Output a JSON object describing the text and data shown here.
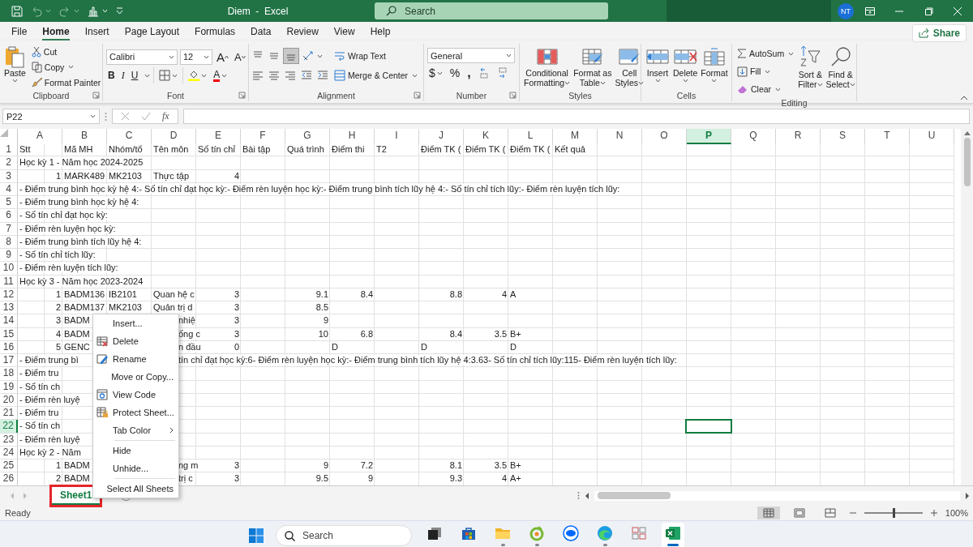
{
  "title_bar": {
    "title": "Diem  -  Excel",
    "search_placeholder": "Search",
    "avatar": "NT"
  },
  "menu_tabs": [
    {
      "label": "File",
      "selected": false
    },
    {
      "label": "Home",
      "selected": true
    },
    {
      "label": "Insert",
      "selected": false
    },
    {
      "label": "Page Layout",
      "selected": false
    },
    {
      "label": "Formulas",
      "selected": false
    },
    {
      "label": "Data",
      "selected": false
    },
    {
      "label": "Review",
      "selected": false
    },
    {
      "label": "View",
      "selected": false
    },
    {
      "label": "Help",
      "selected": false
    }
  ],
  "share_button": "Share",
  "ribbon": {
    "clipboard": {
      "label": "Clipboard",
      "paste": "Paste",
      "cut": "Cut",
      "copy": "Copy",
      "format_painter": "Format Painter"
    },
    "font": {
      "label": "Font",
      "font_name": "Calibri",
      "font_size": "12",
      "grow": "A",
      "shrink": "A",
      "bold": "B",
      "italic": "I",
      "underline": "U",
      "font_color": "A"
    },
    "alignment": {
      "label": "Alignment",
      "vertical_align": [
        {
          "on": false
        },
        {
          "on": false
        },
        {
          "on": true
        }
      ],
      "wrap_text": "Wrap Text",
      "merge_center": "Merge & Center"
    },
    "number": {
      "label": "Number",
      "format": "General",
      "currency": "$",
      "percent": "%",
      "comma": ","
    },
    "styles": {
      "label": "Styles",
      "buttons": [
        {
          "kind": "conditional",
          "lines": [
            "Conditional",
            "Formatting"
          ]
        },
        {
          "kind": "table",
          "lines": [
            "Format as",
            "Table"
          ]
        },
        {
          "kind": "cellstyles",
          "lines": [
            "Cell",
            "Styles"
          ]
        }
      ]
    },
    "cells": {
      "label": "Cells",
      "buttons": [
        {
          "kind": "insert",
          "label": "Insert"
        },
        {
          "kind": "delete",
          "label": "Delete"
        },
        {
          "kind": "format",
          "label": "Format"
        }
      ]
    },
    "editing": {
      "label": "Editing",
      "autosum": "AutoSum",
      "fill": "Fill",
      "clear": "Clear",
      "sort_filter": [
        "Sort &",
        "Filter"
      ],
      "find_select": [
        "Find &",
        "Select"
      ]
    }
  },
  "formula_bar": {
    "name_box": "P22",
    "fx": "fx"
  },
  "sheet": {
    "columns": [
      {
        "label": "A",
        "selected": false
      },
      {
        "label": "B",
        "selected": false
      },
      {
        "label": "C",
        "selected": false
      },
      {
        "label": "D",
        "selected": false
      },
      {
        "label": "E",
        "selected": false
      },
      {
        "label": "F",
        "selected": false
      },
      {
        "label": "G",
        "selected": false
      },
      {
        "label": "H",
        "selected": false
      },
      {
        "label": "I",
        "selected": false
      },
      {
        "label": "J",
        "selected": false
      },
      {
        "label": "K",
        "selected": false
      },
      {
        "label": "L",
        "selected": false
      },
      {
        "label": "M",
        "selected": false
      },
      {
        "label": "N",
        "selected": false
      },
      {
        "label": "O",
        "selected": false
      },
      {
        "label": "P",
        "selected": true
      },
      {
        "label": "Q",
        "selected": false
      },
      {
        "label": "R",
        "selected": false
      },
      {
        "label": "S",
        "selected": false
      },
      {
        "label": "T",
        "selected": false
      },
      {
        "label": "U",
        "selected": false
      }
    ],
    "rows": [
      {
        "label": "1",
        "selected": false,
        "cells": [
          {
            "kind": "text",
            "text": "Stt"
          },
          {
            "kind": "text",
            "text": "Mã MH"
          },
          {
            "kind": "text",
            "text": "Nhóm/tổ"
          },
          {
            "kind": "text",
            "text": "Tên môn"
          },
          {
            "kind": "text",
            "text": "Số tín chỉ"
          },
          {
            "kind": "text",
            "text": "Bài tập"
          },
          {
            "kind": "text",
            "text": "Quá trình"
          },
          {
            "kind": "text",
            "text": "Điểm thi"
          },
          {
            "kind": "text",
            "text": "T2"
          },
          {
            "kind": "text",
            "text": "Điểm TK ("
          },
          {
            "kind": "text",
            "text": "Điểm TK ("
          },
          {
            "kind": "text",
            "text": "Điểm TK ("
          },
          {
            "kind": "text",
            "text": "Kết quả"
          }
        ]
      },
      {
        "label": "2",
        "selected": false,
        "cells": [
          {
            "kind": "text",
            "text": "Học kỳ 1 - Năm học 2024-2025"
          }
        ]
      },
      {
        "label": "3",
        "selected": false,
        "cells": [
          {
            "kind": "number",
            "text": "1"
          },
          {
            "kind": "text",
            "text": "MARK489"
          },
          {
            "kind": "text",
            "text": "MK2103"
          },
          {
            "kind": "text",
            "text": "Thực tập"
          },
          {
            "kind": "number",
            "text": "4"
          }
        ]
      },
      {
        "label": "4",
        "selected": false,
        "cells": [
          {
            "kind": "text",
            "text": "- Điểm trung bình học kỳ hệ 4:- Số tín chỉ đạt học kỳ:- Điểm rèn luyện học kỳ:- Điểm trung bình tích lũy hệ 4:- Số tín chỉ tích lũy:- Điểm rèn luyện tích lũy:"
          }
        ]
      },
      {
        "label": "5",
        "selected": false,
        "cells": [
          {
            "kind": "text",
            "text": "- Điểm trung bình học kỳ hệ 4:"
          }
        ]
      },
      {
        "label": "6",
        "selected": false,
        "cells": [
          {
            "kind": "text",
            "text": "- Số tín chỉ đạt học kỳ:"
          }
        ]
      },
      {
        "label": "7",
        "selected": false,
        "cells": [
          {
            "kind": "text",
            "text": "- Điểm rèn luyện học kỳ:"
          }
        ]
      },
      {
        "label": "8",
        "selected": false,
        "cells": [
          {
            "kind": "text",
            "text": "- Điểm trung bình tích lũy hệ 4:"
          }
        ]
      },
      {
        "label": "9",
        "selected": false,
        "cells": [
          {
            "kind": "text",
            "text": "- Số tín chỉ tích lũy:"
          }
        ]
      },
      {
        "label": "10",
        "selected": false,
        "cells": [
          {
            "kind": "text",
            "text": "- Điểm rèn luyện tích lũy:"
          }
        ]
      },
      {
        "label": "11",
        "selected": false,
        "cells": [
          {
            "kind": "text",
            "text": "Học kỳ 3 - Năm học 2023-2024"
          }
        ]
      },
      {
        "label": "12",
        "selected": false,
        "cells": [
          {
            "kind": "number",
            "text": "1"
          },
          {
            "kind": "text",
            "text": "BADM136"
          },
          {
            "kind": "text",
            "text": "IB2101"
          },
          {
            "kind": "text",
            "text": "Quan hệ c"
          },
          {
            "kind": "number",
            "text": "3"
          },
          {
            "kind": "empty"
          },
          {
            "kind": "number",
            "text": "9.1"
          },
          {
            "kind": "number",
            "text": "8.4"
          },
          {
            "kind": "empty"
          },
          {
            "kind": "number",
            "text": "8.8"
          },
          {
            "kind": "number",
            "text": "4"
          },
          {
            "kind": "text",
            "text": "A"
          }
        ]
      },
      {
        "label": "13",
        "selected": false,
        "cells": [
          {
            "kind": "number",
            "text": "2"
          },
          {
            "kind": "text",
            "text": "BADM137"
          },
          {
            "kind": "text",
            "text": "MK2103"
          },
          {
            "kind": "text",
            "text": "Quản trị d"
          },
          {
            "kind": "number",
            "text": "3"
          },
          {
            "kind": "empty"
          },
          {
            "kind": "number",
            "text": "8.5"
          }
        ]
      },
      {
        "label": "14",
        "selected": false,
        "cells": [
          {
            "kind": "number",
            "text": "3"
          },
          {
            "kind": "text",
            "text": "BADM"
          },
          {
            "kind": "empty"
          },
          {
            "kind": "fragment",
            "text": "nhiệ"
          },
          {
            "kind": "number",
            "text": "3"
          },
          {
            "kind": "empty"
          },
          {
            "kind": "number",
            "text": "9"
          }
        ]
      },
      {
        "label": "15",
        "selected": false,
        "cells": [
          {
            "kind": "number",
            "text": "4"
          },
          {
            "kind": "text",
            "text": "BADM"
          },
          {
            "kind": "empty"
          },
          {
            "kind": "fragment",
            "text": "ống c"
          },
          {
            "kind": "number",
            "text": "3"
          },
          {
            "kind": "empty"
          },
          {
            "kind": "number",
            "text": "10"
          },
          {
            "kind": "number",
            "text": "6.8"
          },
          {
            "kind": "empty"
          },
          {
            "kind": "number",
            "text": "8.4"
          },
          {
            "kind": "number",
            "text": "3.5"
          },
          {
            "kind": "text",
            "text": "B+"
          }
        ]
      },
      {
        "label": "16",
        "selected": false,
        "cells": [
          {
            "kind": "number",
            "text": "5"
          },
          {
            "kind": "text",
            "text": "GENC"
          },
          {
            "kind": "empty"
          },
          {
            "kind": "fragment",
            "text": "n đầu"
          },
          {
            "kind": "number",
            "text": "0"
          },
          {
            "kind": "empty"
          },
          {
            "kind": "empty"
          },
          {
            "kind": "text",
            "text": "D"
          },
          {
            "kind": "empty"
          },
          {
            "kind": "text",
            "text": "D"
          },
          {
            "kind": "empty"
          },
          {
            "kind": "text",
            "text": "D"
          }
        ]
      },
      {
        "label": "17",
        "selected": false,
        "cells": [
          {
            "kind": "text",
            "text": "- Điểm trung bì"
          },
          {
            "kind": "empty"
          },
          {
            "kind": "empty"
          },
          {
            "kind": "fragment",
            "text": "tín chỉ đạt học kỳ:6- Điểm rèn luyện học kỳ:- Điểm trung bình tích lũy hệ 4:3.63- Số tín chỉ tích lũy:115- Điểm rèn luyện tích lũy:"
          }
        ]
      },
      {
        "label": "18",
        "selected": false,
        "cells": [
          {
            "kind": "text",
            "text": "- Điểm tru"
          }
        ]
      },
      {
        "label": "19",
        "selected": false,
        "cells": [
          {
            "kind": "text",
            "text": "- Số tín ch"
          }
        ]
      },
      {
        "label": "20",
        "selected": false,
        "cells": [
          {
            "kind": "text",
            "text": "- Điểm rèn luyệ"
          }
        ]
      },
      {
        "label": "21",
        "selected": false,
        "cells": [
          {
            "kind": "text",
            "text": "- Điểm tru"
          }
        ]
      },
      {
        "label": "22",
        "selected": true,
        "cells": [
          {
            "kind": "text",
            "text": "- Số tín ch"
          }
        ]
      },
      {
        "label": "23",
        "selected": false,
        "cells": [
          {
            "kind": "text",
            "text": "- Điểm rèn luyệ"
          }
        ]
      },
      {
        "label": "24",
        "selected": false,
        "cells": [
          {
            "kind": "text",
            "text": "Học kỳ 2 - Năm"
          }
        ]
      },
      {
        "label": "25",
        "selected": false,
        "cells": [
          {
            "kind": "number",
            "text": "1"
          },
          {
            "kind": "text",
            "text": "BADM"
          },
          {
            "kind": "empty"
          },
          {
            "kind": "fragment",
            "text": "ng m"
          },
          {
            "kind": "number",
            "text": "3"
          },
          {
            "kind": "empty"
          },
          {
            "kind": "number",
            "text": "9"
          },
          {
            "kind": "number",
            "text": "7.2"
          },
          {
            "kind": "empty"
          },
          {
            "kind": "number",
            "text": "8.1"
          },
          {
            "kind": "number",
            "text": "3.5"
          },
          {
            "kind": "text",
            "text": "B+"
          }
        ]
      },
      {
        "label": "26",
        "selected": false,
        "cells": [
          {
            "kind": "number",
            "text": "2"
          },
          {
            "kind": "text",
            "text": "BADM"
          },
          {
            "kind": "empty"
          },
          {
            "kind": "fragment",
            "text": "trị c"
          },
          {
            "kind": "number",
            "text": "3"
          },
          {
            "kind": "empty"
          },
          {
            "kind": "number",
            "text": "9.5"
          },
          {
            "kind": "number",
            "text": "9"
          },
          {
            "kind": "empty"
          },
          {
            "kind": "number",
            "text": "9.3"
          },
          {
            "kind": "number",
            "text": "4"
          },
          {
            "kind": "text",
            "text": "A+"
          }
        ]
      }
    ]
  },
  "sheet_tabs": [
    {
      "label": "Sheet1",
      "selected": true,
      "highlighted": true
    }
  ],
  "context_menu": [
    {
      "kind": "plain",
      "label": "Insert..."
    },
    {
      "kind": "delete",
      "label": "Delete"
    },
    {
      "kind": "rename",
      "label": "Rename"
    },
    {
      "kind": "plain",
      "label": "Move or Copy..."
    },
    {
      "kind": "code",
      "label": "View Code"
    },
    {
      "kind": "protect",
      "label": "Protect Sheet..."
    },
    {
      "kind": "submenu",
      "label": "Tab Color"
    },
    {
      "kind": "separator"
    },
    {
      "kind": "plain",
      "label": "Hide"
    },
    {
      "kind": "plain",
      "label": "Unhide..."
    },
    {
      "kind": "separator"
    },
    {
      "kind": "plain",
      "label": "Select All Sheets"
    }
  ],
  "status_bar": {
    "status": "Ready",
    "views": [
      {
        "kind": "normal",
        "selected": true
      },
      {
        "kind": "pagelayout",
        "selected": false
      },
      {
        "kind": "pagebreak",
        "selected": false
      }
    ],
    "zoom": {
      "level": 0.5,
      "reading": "100%"
    }
  },
  "taskbar": {
    "search_placeholder": "Search",
    "apps": [
      {
        "kind": "taskview",
        "running": false,
        "active": false
      },
      {
        "kind": "store",
        "running": false,
        "active": false
      },
      {
        "kind": "folder",
        "running": true,
        "active": false
      },
      {
        "kind": "greenapp",
        "running": true,
        "active": false
      },
      {
        "kind": "chat",
        "running": false,
        "active": false
      },
      {
        "kind": "browser",
        "running": true,
        "active": false
      },
      {
        "kind": "tiles",
        "running": false,
        "active": false
      },
      {
        "kind": "excel",
        "running": true,
        "active": true
      }
    ]
  }
}
